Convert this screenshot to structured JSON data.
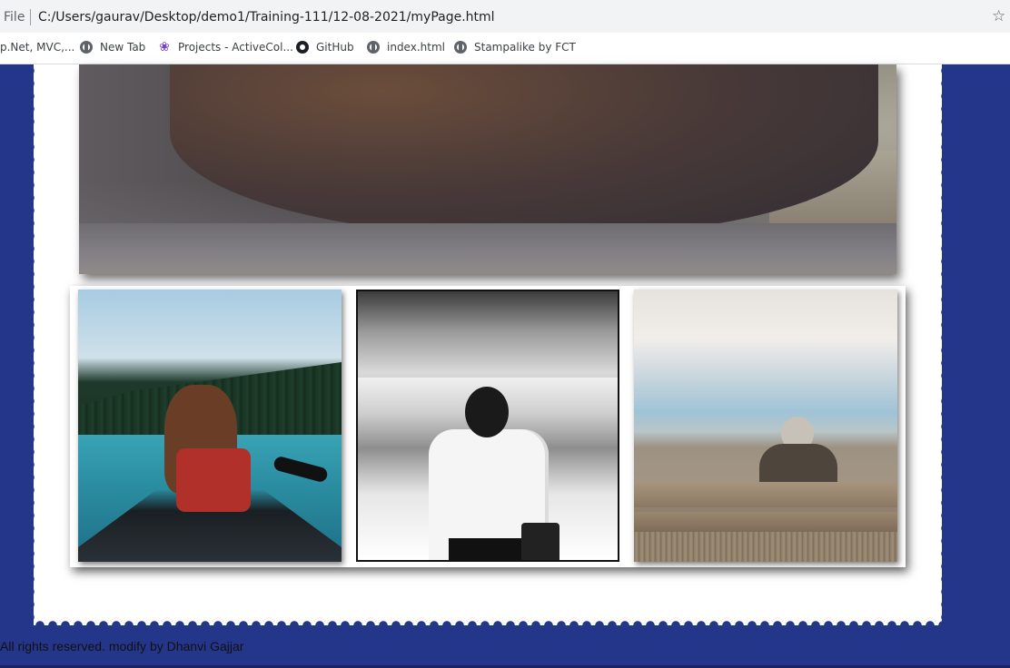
{
  "browser": {
    "file_label": "File",
    "url": "C:/Users/gaurav/Desktop/demo1/Training-111/12-08-2021/myPage.html"
  },
  "bookmarks": [
    {
      "label": "p.Net, MVC,...",
      "icon": "none"
    },
    {
      "label": "New Tab",
      "icon": "globe-icon"
    },
    {
      "label": "Projects - ActiveCol...",
      "icon": "projects-icon"
    },
    {
      "label": "GitHub",
      "icon": "github-icon"
    },
    {
      "label": "index.html",
      "icon": "globe-icon"
    },
    {
      "label": "Stampalike by FCT",
      "icon": "globe-icon"
    }
  ],
  "page": {
    "background_color": "#24368a",
    "stamp_color": "#ffffff",
    "footer_text": "All rights reserved. modify by Dhanvi Gajjar"
  }
}
